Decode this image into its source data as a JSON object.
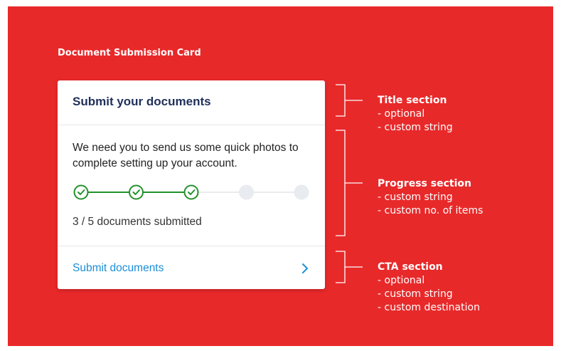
{
  "heading": "Document Submission Card",
  "card": {
    "title": "Submit your documents",
    "description": "We need you to send us some quick photos to complete setting up your account.",
    "progress": {
      "completed": 3,
      "total": 5
    },
    "status_text": "3 / 5 documents submitted",
    "cta_label": "Submit documents",
    "cta_icon": "chevron-right-icon"
  },
  "annotations": [
    {
      "title": "Title section",
      "items": [
        "- optional",
        "- custom string"
      ]
    },
    {
      "title": "Progress section",
      "items": [
        "- custom string",
        "- custom no. of items"
      ]
    },
    {
      "title": "CTA section",
      "items": [
        "- optional",
        "- custom string",
        "- custom destination"
      ]
    }
  ],
  "colors": {
    "background": "#e8292a",
    "step_done": "#23912b",
    "step_pending": "#e8ebef",
    "link": "#1a8fd8",
    "title": "#1f2f5a"
  }
}
